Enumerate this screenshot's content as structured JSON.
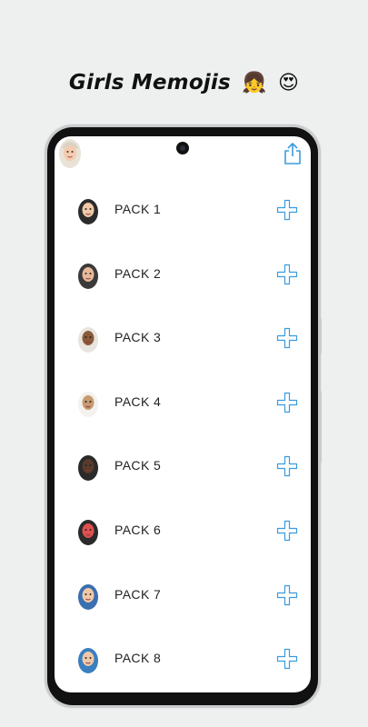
{
  "header": {
    "title": "Girls Memojis",
    "emojis": [
      "👧",
      "😍"
    ]
  },
  "toolbar": {
    "avatar_icon": "hijab-girl-memoji-icon",
    "share_icon": "share-icon"
  },
  "packs": [
    {
      "label": "PACK 1",
      "icon": "memoji-girl-black-hijab-icon",
      "skin": "#f0c8a8",
      "scarf": "#2b2b2b"
    },
    {
      "label": "PACK 2",
      "icon": "memoji-girl-heart-hands-icon",
      "skin": "#e8b89a",
      "scarf": "#3a3a3a"
    },
    {
      "label": "PACK 3",
      "icon": "memoji-girl-white-hijab-icon",
      "skin": "#8a5a3a",
      "scarf": "#e8e4de"
    },
    {
      "label": "PACK 4",
      "icon": "memoji-girl-sunglasses-icon",
      "skin": "#c89a70",
      "scarf": "#f4f2ee"
    },
    {
      "label": "PACK 5",
      "icon": "memoji-girl-niqab-icon",
      "skin": "#5a3a2a",
      "scarf": "#2a2a2a"
    },
    {
      "label": "PACK 6",
      "icon": "memoji-girl-heart-eyes-icon",
      "skin": "#e05050",
      "scarf": "#2a2a2a"
    },
    {
      "label": "PACK 7",
      "icon": "memoji-girl-surprised-icon",
      "skin": "#f0c8a8",
      "scarf": "#3a6fb0"
    },
    {
      "label": "PACK 8",
      "icon": "memoji-girl-waving-icon",
      "skin": "#f0c8a8",
      "scarf": "#3a7fc0"
    }
  ],
  "add_icon": "plus-icon",
  "colors": {
    "accent": "#3b9be0",
    "background": "#eef0f0"
  }
}
